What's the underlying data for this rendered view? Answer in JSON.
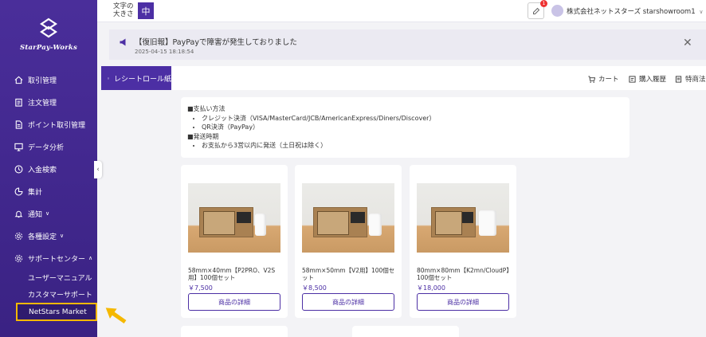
{
  "brand": {
    "logo_text": "StarPay-Works"
  },
  "sidebar": {
    "items": [
      {
        "label": "取引管理",
        "icon": "home-icon"
      },
      {
        "label": "注文管理",
        "icon": "clipboard-icon"
      },
      {
        "label": "ポイント取引管理",
        "icon": "document-icon"
      },
      {
        "label": "データ分析",
        "icon": "monitor-icon"
      },
      {
        "label": "入金検索",
        "icon": "clock-icon"
      },
      {
        "label": "集計",
        "icon": "pie-icon"
      },
      {
        "label": "通知",
        "icon": "bell-icon",
        "caret": "∨"
      },
      {
        "label": "各種設定",
        "icon": "gear-icon",
        "caret": "∨"
      },
      {
        "label": "サポートセンター",
        "icon": "gear-icon",
        "caret": "∧"
      }
    ],
    "subitems": [
      {
        "label": "ユーザーマニュアル"
      },
      {
        "label": "カスタマーサポート"
      },
      {
        "label": "NetStars Market"
      }
    ],
    "collapse_glyph": "‹"
  },
  "topbar": {
    "fontsize_label_line1": "文字の",
    "fontsize_label_line2": "大きさ",
    "fontsize_value": "中",
    "notify_count": "1",
    "username": "株式会社ネットスターズ starshowroom1",
    "username_caret": "∨"
  },
  "alert": {
    "text": "【復旧報】PayPayで障害が発生しておりました",
    "time": "2025-04-15 18:18:54",
    "close": "✕"
  },
  "tabs": {
    "active_label": "レシートロール紙",
    "links": [
      {
        "label": "カート",
        "icon": "cart-icon"
      },
      {
        "label": "購入履歴",
        "icon": "history-icon"
      },
      {
        "label": "特商法",
        "icon": "doc-icon"
      }
    ]
  },
  "info": {
    "payment_heading": "■支払い方法",
    "payment_items": [
      "クレジット決済（VISA/MasterCard/JCB/AmericanExpress/Diners/Discover）",
      "QR決済（PayPay）"
    ],
    "shipping_heading": "■発送時期",
    "shipping_items": [
      "お支払から3営以内に発送（土日祝は除く）"
    ]
  },
  "products": [
    {
      "title": "58mm×40mm【P2PRO、V2S用】100個セット",
      "price": "￥7,500",
      "button": "商品の詳細"
    },
    {
      "title": "58mm×50mm【V2用】100個セット",
      "price": "￥8,500",
      "button": "商品の詳細"
    },
    {
      "title": "80mm×80mm【K2mn/CloudP】100個セット",
      "price": "￥18,000",
      "button": "商品の詳細"
    }
  ]
}
